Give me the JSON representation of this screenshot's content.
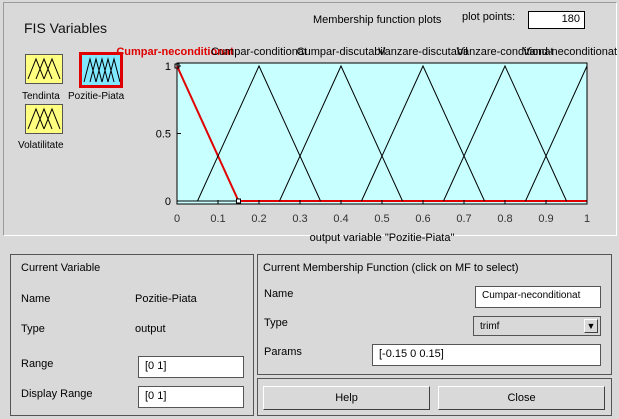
{
  "fis": {
    "title": "FIS Variables"
  },
  "variables": [
    {
      "label": "Tendinta",
      "kind": "input"
    },
    {
      "label": "Pozitie-Piata",
      "kind": "output"
    },
    {
      "label": "Volatilitate",
      "kind": "input"
    }
  ],
  "plot": {
    "title": "Membership function plots",
    "points_label": "plot points:",
    "points_value": "180",
    "xlabel": "output variable \"Pozitie-Piata\"",
    "xticks": [
      "0",
      "0.1",
      "0.2",
      "0.3",
      "0.4",
      "0.5",
      "0.6",
      "0.7",
      "0.8",
      "0.9",
      "1"
    ],
    "yticks": [
      "0",
      "0.5",
      "1"
    ],
    "bg_color": "#c8ffff",
    "line_color": "#000000",
    "selected_color": "#e00000"
  },
  "chart_data": {
    "type": "line",
    "title": "Membership function plots",
    "xlabel": "output variable \"Pozitie-Piata\"",
    "ylabel": "",
    "xlim": [
      0,
      1
    ],
    "ylim": [
      0,
      1
    ],
    "series": [
      {
        "name": "Cumpar-neconditionat",
        "params": [
          -0.15,
          0,
          0.15
        ],
        "selected": true
      },
      {
        "name": "Cumpar-conditionat",
        "params": [
          0.05,
          0.2,
          0.35
        ],
        "selected": false
      },
      {
        "name": "Cumpar-discutabil",
        "params": [
          0.25,
          0.4,
          0.55
        ],
        "selected": false
      },
      {
        "name": "Vanzare-discutabil",
        "params": [
          0.45,
          0.6,
          0.75
        ],
        "selected": false
      },
      {
        "name": "Vanzare-conditionat",
        "params": [
          0.65,
          0.8,
          0.95
        ],
        "selected": false
      },
      {
        "name": "Vand-neconditionat",
        "params": [
          0.85,
          1.0,
          1.15
        ],
        "selected": false
      }
    ]
  },
  "plot_labels": {
    "mf1": "Cumpar-neconditionat",
    "mf2": "Cumpar-conditionat",
    "mf3": "Cumpar-discutabil",
    "mf4": "Vanzare-discutabil",
    "mf5": "Vanzare-conditionat",
    "mf6": "Vand-neconditionat"
  },
  "current_variable": {
    "heading": "Current Variable",
    "name_label": "Name",
    "name_value": "Pozitie-Piata",
    "type_label": "Type",
    "type_value": "output",
    "range_label": "Range",
    "range_value": "[0 1]",
    "display_range_label": "Display Range",
    "display_range_value": "[0 1]"
  },
  "current_mf": {
    "heading": "Current Membership Function (click on MF to select)",
    "name_label": "Name",
    "name_value": "Cumpar-neconditionat",
    "type_label": "Type",
    "type_value": "trimf",
    "params_label": "Params",
    "params_value": "[-0.15 0 0.15]"
  },
  "buttons": {
    "help": "Help",
    "close": "Close"
  }
}
